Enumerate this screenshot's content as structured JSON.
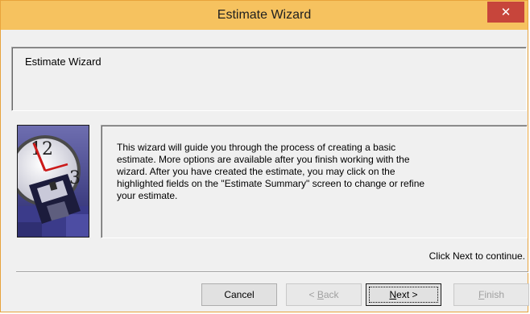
{
  "window": {
    "title": "Estimate Wizard",
    "close_label": "✕"
  },
  "header": {
    "label": "Estimate Wizard"
  },
  "body": {
    "text_lines": [
      "This wizard will guide you through the process of creating a basic",
      "estimate. More options are available after you finish working with the",
      "wizard. After you have created the estimate, you may click on the",
      "highlighted fields on the \"Estimate Summary\" screen to change or refine",
      "your estimate."
    ]
  },
  "picture": {
    "icon": "clock-and-floppy-disk-icon",
    "clock_numbers": [
      "12",
      "3"
    ]
  },
  "hint": "Click Next to continue.",
  "buttons": {
    "cancel": {
      "label": "Cancel"
    },
    "back": {
      "prefix": "< ",
      "mnemonic": "B",
      "rest": "ack"
    },
    "next": {
      "mnemonic": "N",
      "rest": "ext >"
    },
    "finish": {
      "mnemonic": "F",
      "rest": "inish"
    }
  },
  "colors": {
    "titlebar": "#f6c25f",
    "close": "#c7453b"
  }
}
